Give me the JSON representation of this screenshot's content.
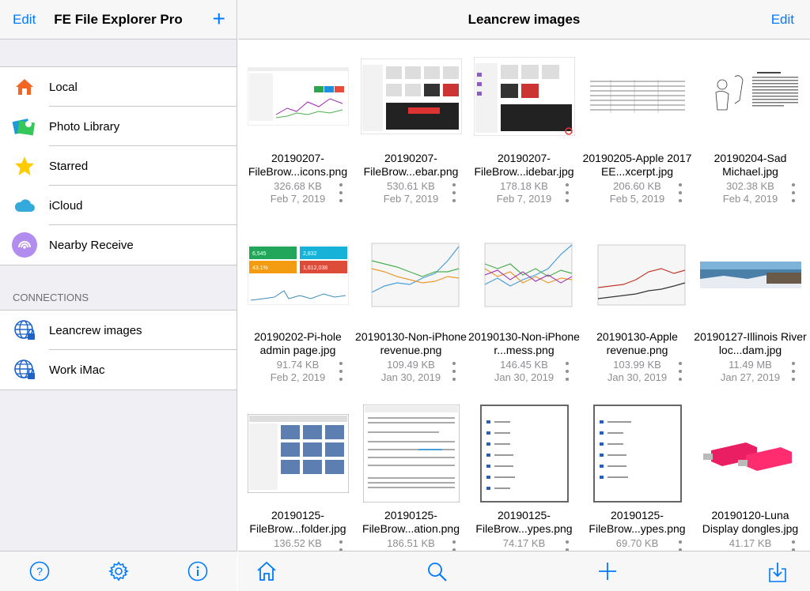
{
  "sidebar": {
    "edit_label": "Edit",
    "title": "FE File Explorer Pro",
    "add_label": "+",
    "items": [
      {
        "label": "Local",
        "icon": "house-icon"
      },
      {
        "label": "Photo Library",
        "icon": "photo-library-icon"
      },
      {
        "label": "Starred",
        "icon": "star-icon"
      },
      {
        "label": "iCloud",
        "icon": "icloud-icon"
      },
      {
        "label": "Nearby Receive",
        "icon": "nearby-receive-icon"
      }
    ],
    "connections_header": "CONNECTIONS",
    "connections": [
      {
        "label": "Leancrew images",
        "icon": "globe-lock-icon"
      },
      {
        "label": "Work iMac",
        "icon": "globe-lock-icon"
      }
    ],
    "toolbar": [
      "help-icon",
      "settings-gear-icon",
      "info-icon"
    ]
  },
  "main": {
    "title": "Leancrew images",
    "edit_label": "Edit",
    "files": [
      {
        "name": "20190207-FileBrow...icons.png",
        "size": "326.68 KB",
        "date": "Feb 7, 2019"
      },
      {
        "name": "20190207-FileBrow...ebar.png",
        "size": "530.61 KB",
        "date": "Feb 7, 2019"
      },
      {
        "name": "20190207-FileBrow...idebar.jpg",
        "size": "178.18 KB",
        "date": "Feb 7, 2019"
      },
      {
        "name": "20190205-Apple 2017 EE...xcerpt.jpg",
        "size": "206.60 KB",
        "date": "Feb 5, 2019"
      },
      {
        "name": "20190204-Sad Michael.jpg",
        "size": "302.38 KB",
        "date": "Feb 4, 2019"
      },
      {
        "name": "20190202-Pi-hole admin page.jpg",
        "size": "91.74 KB",
        "date": "Feb 2, 2019"
      },
      {
        "name": "20190130-Non-iPhone revenue.png",
        "size": "109.49 KB",
        "date": "Jan 30, 2019"
      },
      {
        "name": "20190130-Non-iPhone r...mess.png",
        "size": "146.45 KB",
        "date": "Jan 30, 2019"
      },
      {
        "name": "20190130-Apple revenue.png",
        "size": "103.99 KB",
        "date": "Jan 30, 2019"
      },
      {
        "name": "20190127-Illinois River loc...dam.jpg",
        "size": "11.49 MB",
        "date": "Jan 27, 2019"
      },
      {
        "name": "20190125-FileBrow...folder.jpg",
        "size": "136.52 KB",
        "date": ""
      },
      {
        "name": "20190125-FileBrow...ation.png",
        "size": "186.51 KB",
        "date": ""
      },
      {
        "name": "20190125-FileBrow...ypes.png",
        "size": "74.17 KB",
        "date": ""
      },
      {
        "name": "20190125-FileBrow...ypes.png",
        "size": "69.70 KB",
        "date": ""
      },
      {
        "name": "20190120-Luna Display dongles.jpg",
        "size": "41.17 KB",
        "date": ""
      }
    ],
    "toolbar": [
      "home-icon",
      "search-icon",
      "add-icon",
      "download-icon"
    ]
  },
  "colors": {
    "accent": "#007aff",
    "sidebar_bg": "#efeff4",
    "secondary_text": "#8e8e93"
  }
}
